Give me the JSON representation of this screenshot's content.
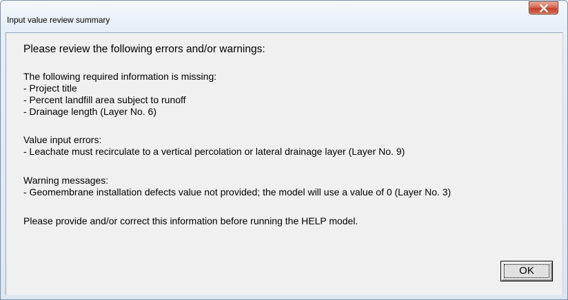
{
  "window": {
    "title": "Input value review summary",
    "close_icon": "close-x-icon"
  },
  "dialog": {
    "heading": "Please review the following errors and/or warnings:",
    "missing_header": "The following required information is missing:",
    "missing_items": [
      "-  Project title",
      "-  Percent landfill area subject to runoff",
      "-  Drainage length (Layer No. 6)"
    ],
    "errors_header": "Value input errors:",
    "error_items": [
      "-  Leachate must recirculate to a vertical percolation or lateral drainage layer (Layer No. 9)"
    ],
    "warnings_header": "Warning messages:",
    "warning_items": [
      "-  Geomembrane installation defects value not provided; the model will use a value of 0 (Layer No. 3)"
    ],
    "footer": "Please provide and/or correct this information before running the HELP model.",
    "ok_label": "OK"
  },
  "colors": {
    "close_button": "#c4412a",
    "client_background": "#f0f0f0"
  }
}
